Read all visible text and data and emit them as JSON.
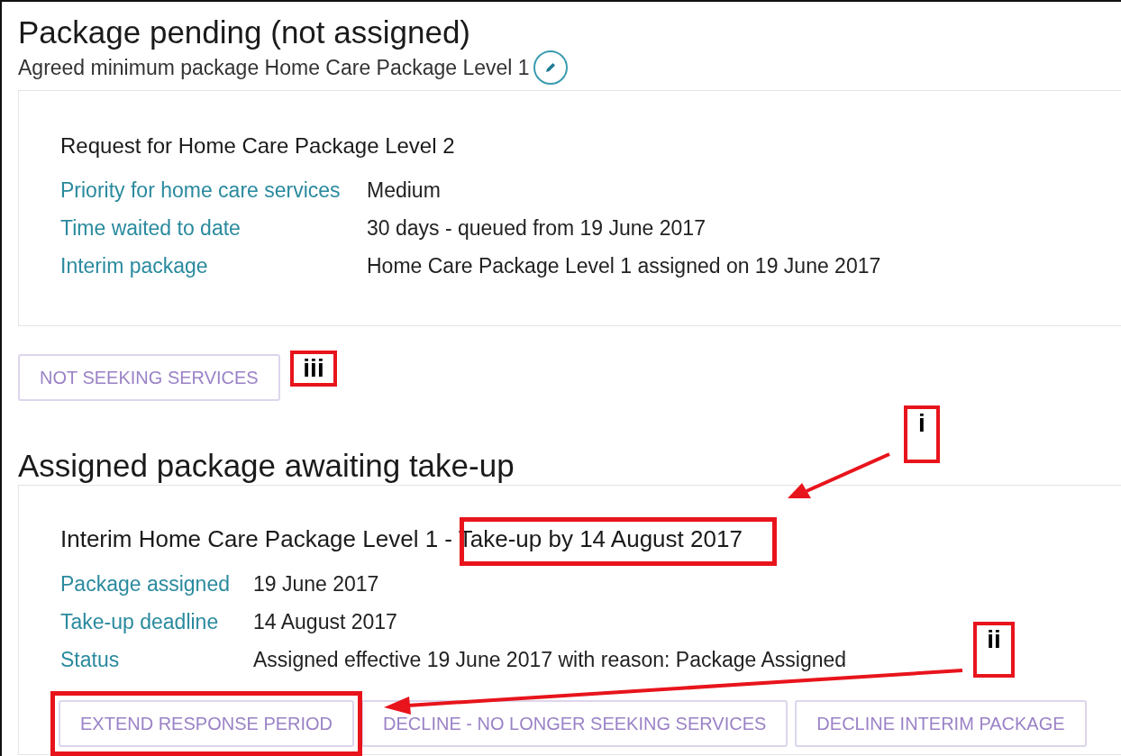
{
  "pending": {
    "heading": "Package pending (not assigned)",
    "subtitle": "Agreed minimum package Home Care Package Level 1",
    "card": {
      "title": "Request for Home Care Package Level 2",
      "rows": [
        {
          "label": "Priority for home care services",
          "value": "Medium"
        },
        {
          "label": "Time waited to date",
          "value": "30 days - queued from 19 June 2017"
        },
        {
          "label": "Interim package",
          "value": "Home Care Package Level 1 assigned on 19 June 2017"
        }
      ]
    },
    "buttons": [
      "NOT SEEKING SERVICES"
    ]
  },
  "assigned": {
    "heading": "Assigned package awaiting take-up",
    "card": {
      "title": "Interim Home Care Package Level 1 - Take-up by 14 August 2017",
      "rows": [
        {
          "label": "Package assigned",
          "value": "19 June 2017"
        },
        {
          "label": "Take-up deadline",
          "value": "14 August 2017"
        },
        {
          "label": "Status",
          "value": "Assigned effective 19 June 2017 with reason: Package Assigned"
        }
      ],
      "buttons": [
        "EXTEND RESPONSE PERIOD",
        "DECLINE - NO LONGER SEEKING SERVICES",
        "DECLINE INTERIM PACKAGE"
      ]
    }
  },
  "annotations": [
    {
      "label": "iii"
    },
    {
      "label": "i"
    },
    {
      "label": "ii"
    }
  ]
}
